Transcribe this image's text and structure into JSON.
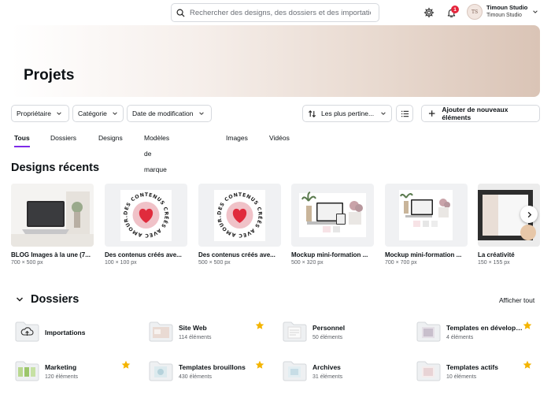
{
  "search": {
    "placeholder": "Rechercher des designs, des dossiers et des importations"
  },
  "header": {
    "notifications_count": "1",
    "account_name": "Timoun Studio",
    "account_team": "Timoun Studio",
    "avatar_text": "TS"
  },
  "banner": {
    "title": "Projets"
  },
  "filters": {
    "owner": "Propriétaire",
    "category": "Catégorie",
    "modified": "Date de modification"
  },
  "sort": {
    "label": "Les plus pertine..."
  },
  "add_button": {
    "label": "Ajouter de nouveaux éléments"
  },
  "tabs": [
    "Tous",
    "Dossiers",
    "Designs",
    "Modèles de marque",
    "Images",
    "Vidéos"
  ],
  "recent": {
    "title": "Designs récents",
    "items": [
      {
        "name": "BLOG Images à la une (7...",
        "size": "700 × 500 px"
      },
      {
        "name": "Des contenus créés ave...",
        "size": "100 × 100 px",
        "badge_text": "DES CONTENUS CRÉÉS AVEC AMOUR."
      },
      {
        "name": "Des contenus créés ave...",
        "size": "500 × 500 px",
        "badge_text": "DES CONTENUS CRÉÉS AVEC AMOUR."
      },
      {
        "name": "Mockup mini-formation ...",
        "size": "500 × 320 px"
      },
      {
        "name": "Mockup mini-formation ...",
        "size": "700 × 700 px"
      },
      {
        "name": "La créativité",
        "size": "150 × 155 px"
      }
    ]
  },
  "folders": {
    "title": "Dossiers",
    "show_all": "Afficher tout",
    "items": [
      {
        "name": "Importations",
        "count": "",
        "starred": false
      },
      {
        "name": "Site Web",
        "count": "114 éléments",
        "starred": true
      },
      {
        "name": "Personnel",
        "count": "50 éléments",
        "starred": false
      },
      {
        "name": "Templates en développ...",
        "count": "4 éléments",
        "starred": true
      },
      {
        "name": "Marketing",
        "count": "120 éléments",
        "starred": true
      },
      {
        "name": "Templates brouillons",
        "count": "430 éléments",
        "starred": true
      },
      {
        "name": "Archives",
        "count": "31 éléments",
        "starred": false
      },
      {
        "name": "Templates actifs",
        "count": "10 éléments",
        "starred": true
      }
    ]
  },
  "colors": {
    "accent": "#7d2ae8",
    "star": "#f4b400",
    "heart": "#e02b3c",
    "badge": "#e5243b"
  }
}
